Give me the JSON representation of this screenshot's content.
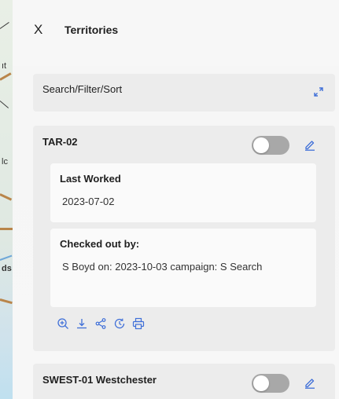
{
  "header": {
    "close_label": "X",
    "title": "Territories"
  },
  "search": {
    "label": "Search/Filter/Sort",
    "icon": "expand-icon"
  },
  "map_labels": [
    "ıt",
    "lc",
    "ds"
  ],
  "territories": [
    {
      "name": "TAR-02",
      "toggle_on": false,
      "last_worked_label": "Last Worked",
      "last_worked_value": "2023-07-02",
      "checked_out_label": "Checked out by:",
      "checked_out_value": "S Boyd on: 2023-10-03 campaign: S Search",
      "actions": [
        "zoom-in-icon",
        "download-icon",
        "share-icon",
        "history-icon",
        "print-icon"
      ]
    },
    {
      "name": "SWEST-01 Westchester",
      "toggle_on": false
    }
  ],
  "colors": {
    "accent": "#3f6fd8",
    "toggle_off": "#a8a8a8",
    "panel_bg": "#f7f7f7",
    "card_bg": "#ececec"
  }
}
